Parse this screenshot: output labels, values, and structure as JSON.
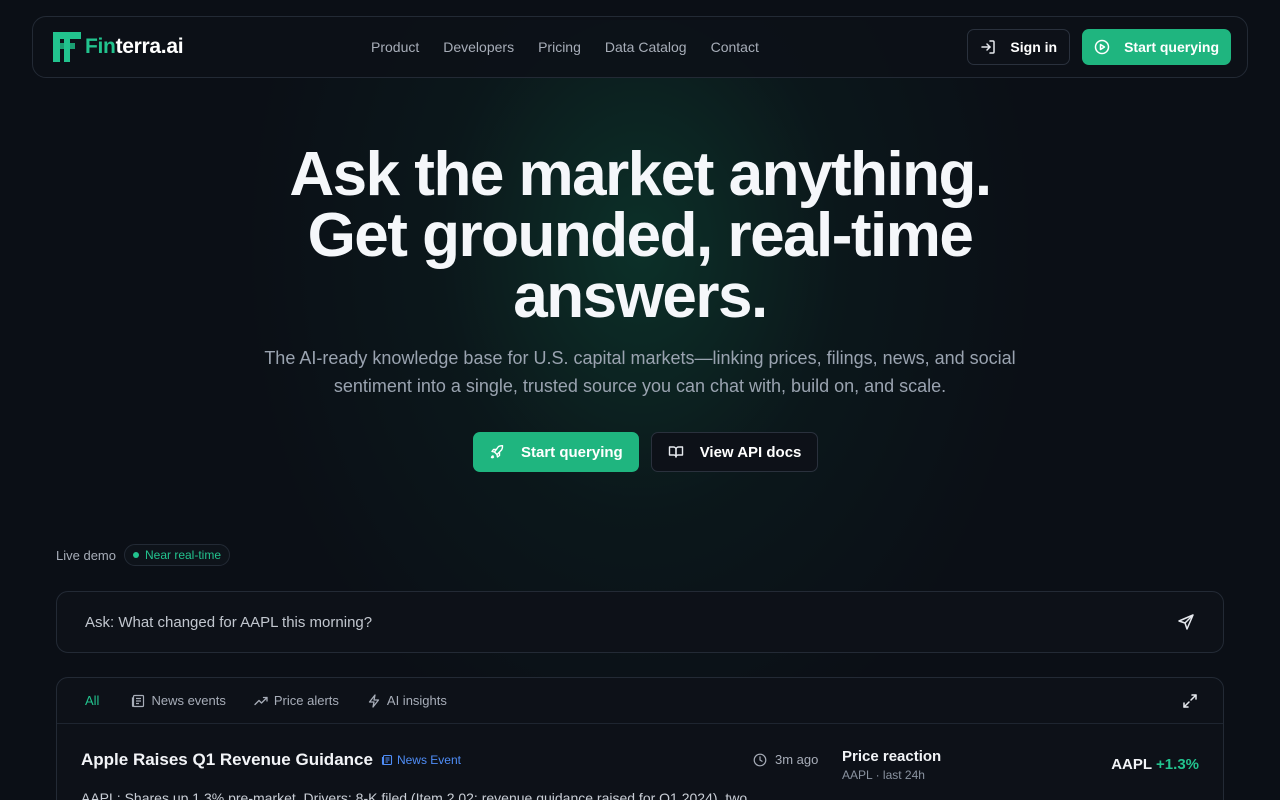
{
  "brand": {
    "name_prefix": "Fin",
    "name_suffix": "terra.ai",
    "accent": "#1fb57f"
  },
  "nav": {
    "links": [
      "Product",
      "Developers",
      "Pricing",
      "Data Catalog",
      "Contact"
    ],
    "sign_in": "Sign in",
    "start": "Start querying"
  },
  "hero": {
    "line1": "Ask the market anything.",
    "line2": "Get grounded, real-time",
    "line3": "answers.",
    "subtitle": "The AI-ready knowledge base for U.S. capital markets—linking prices, filings, news, and social sentiment into a single, trusted source you can chat with, build on, and scale.",
    "primary": "Start querying",
    "secondary": "View API docs"
  },
  "demo": {
    "label": "Live demo",
    "status": "Near real-time",
    "ask_placeholder": "Ask: What changed for AAPL this morning?",
    "tabs": [
      "All",
      "News events",
      "Price alerts",
      "AI insights"
    ],
    "item": {
      "title": "Apple Raises Q1 Revenue Guidance",
      "badge": "News Event",
      "time": "3m ago",
      "reaction_title": "Price reaction",
      "reaction_sub": "AAPL · last 24h",
      "ticker": "AAPL",
      "change": "+1.3%",
      "body": "AAPL: Shares up 1.3% pre-market. Drivers: 8-K filed (Item 2.02: revenue guidance raised for Q1 2024), two"
    }
  }
}
